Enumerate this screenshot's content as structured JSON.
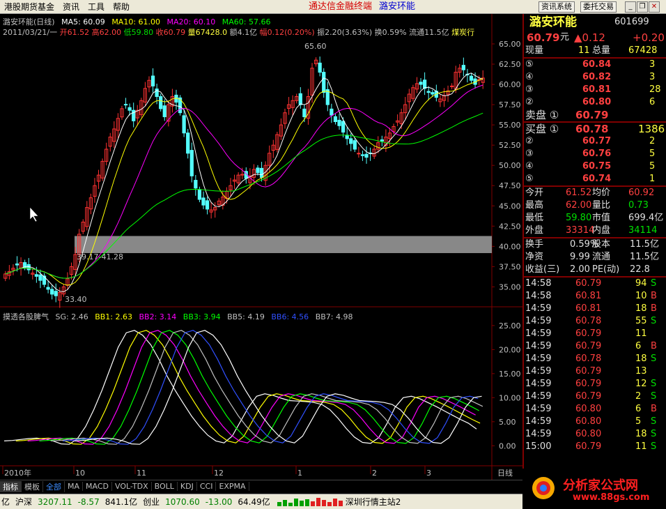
{
  "menubar": {
    "title": "港股期货基金",
    "menu1": "资讯",
    "menu2": "工具",
    "menu3": "帮助",
    "center": "通达信金融终端",
    "stock": "潞安环能",
    "btn1": "资讯系统",
    "btn2": "委托交易"
  },
  "legend": {
    "name": "潞安环能(日线)",
    "ma5": "MA5: 60.09",
    "ma10": "MA10: 61.00",
    "ma20": "MA20: 60.10",
    "ma60": "MA60: 57.66"
  },
  "info": {
    "date": "2011/03/21/一",
    "open": "开61.52",
    "high": "高62.00",
    "low": "低59.80",
    "close": "收60.79",
    "vol": "量67428.0",
    "amt": "额4.1亿",
    "chg": "幅0.12(0.20%)",
    "amp": "振2.20(3.63%)",
    "turn": "换0.59%",
    "flow": "流通11.5亿",
    "ind": "煤炭行"
  },
  "sub": {
    "name": "摸透各股脾气",
    "sg": "SG: 2.46",
    "bb1": "BB1: 2.63",
    "bb2": "BB2: 3.14",
    "bb3": "BB3: 3.94",
    "bb5": "BB5: 4.19",
    "bb6": "BB6: 4.56",
    "bb7": "BB7: 4.98"
  },
  "tags": {
    "high": "65.60",
    "low": "33.40",
    "range": "39.17-41.28"
  },
  "timeaxis": {
    "year": "2010年",
    "m10": "10",
    "m11": "11",
    "m12": "12",
    "m1": "1",
    "m2": "2",
    "m3": "3",
    "period": "日线"
  },
  "tabs": [
    "指标",
    "模板",
    "全部",
    "MA",
    "MACD",
    "VOL-TDX",
    "BOLL",
    "KDJ",
    "CCI",
    "EXPMA"
  ],
  "status": {
    "prefix": "亿",
    "sh": "沪深",
    "shv": "3207.11",
    "shc": "-8.57",
    "sha": "841.1亿",
    "cy": "创业",
    "cyv": "1070.60",
    "cyc": "-13.00",
    "cya": "64.49亿",
    "server": "深圳行情主站2"
  },
  "quote": {
    "name": "潞安环能",
    "code": "601699",
    "price": "60.79",
    "unit": "元",
    "chg": "▲0.12",
    "chg2": "+0.20",
    "xl_label": "现量",
    "xl": "11",
    "zl_label": "总量",
    "zl": "67428"
  },
  "sells": [
    {
      "l": "⑤",
      "p": "60.84",
      "v": "3"
    },
    {
      "l": "④",
      "p": "60.82",
      "v": "3"
    },
    {
      "l": "③",
      "p": "60.81",
      "v": "28"
    },
    {
      "l": "②",
      "p": "60.80",
      "v": "6"
    },
    {
      "l": "卖盘 ①",
      "p": "60.79",
      "v": ""
    }
  ],
  "buys": [
    {
      "l": "买盘 ①",
      "p": "60.78",
      "v": "1386"
    },
    {
      "l": "②",
      "p": "60.77",
      "v": "2"
    },
    {
      "l": "③",
      "p": "60.76",
      "v": "5"
    },
    {
      "l": "④",
      "p": "60.75",
      "v": "5"
    },
    {
      "l": "⑤",
      "p": "60.74",
      "v": "1"
    }
  ],
  "stats1": [
    {
      "a": "今开",
      "b": "61.52",
      "c": "均价",
      "d": "60.92"
    },
    {
      "a": "最高",
      "b": "62.00",
      "c": "量比",
      "d": "0.73"
    },
    {
      "a": "最低",
      "b": "59.80",
      "c": "市值",
      "d": "699.4亿"
    },
    {
      "a": "外盘",
      "b": "33314",
      "c": "内盘",
      "d": "34114"
    }
  ],
  "stats2": [
    {
      "a": "换手",
      "b": "0.59%",
      "c": "股本",
      "d": "11.5亿"
    },
    {
      "a": "净资",
      "b": "9.99",
      "c": "流通",
      "d": "11.5亿"
    },
    {
      "a": "收益(三)",
      "b": "2.00",
      "c": "PE(动)",
      "d": "22.8"
    }
  ],
  "ticks": [
    {
      "t": "14:58",
      "p": "60.79",
      "v": "94",
      "s": "S"
    },
    {
      "t": "14:58",
      "p": "60.81",
      "v": "10",
      "s": "B"
    },
    {
      "t": "14:59",
      "p": "60.81",
      "v": "18",
      "s": "B"
    },
    {
      "t": "14:59",
      "p": "60.78",
      "v": "55",
      "s": "S"
    },
    {
      "t": "14:59",
      "p": "60.79",
      "v": "11",
      "s": ""
    },
    {
      "t": "14:59",
      "p": "60.79",
      "v": "6",
      "s": "B"
    },
    {
      "t": "14:59",
      "p": "60.78",
      "v": "18",
      "s": "S"
    },
    {
      "t": "14:59",
      "p": "60.79",
      "v": "13",
      "s": ""
    },
    {
      "t": "14:59",
      "p": "60.79",
      "v": "12",
      "s": "S"
    },
    {
      "t": "14:59",
      "p": "60.79",
      "v": "2",
      "s": "S"
    },
    {
      "t": "14:59",
      "p": "60.80",
      "v": "6",
      "s": "B"
    },
    {
      "t": "14:59",
      "p": "60.80",
      "v": "5",
      "s": "S"
    },
    {
      "t": "14:59",
      "p": "60.80",
      "v": "18",
      "s": "S"
    },
    {
      "t": "15:00",
      "p": "60.79",
      "v": "11",
      "s": "S"
    }
  ],
  "yaxis_main": [
    "65.00",
    "62.50",
    "60.00",
    "57.50",
    "55.00",
    "52.50",
    "50.00",
    "47.50",
    "45.00",
    "42.50",
    "40.00",
    "37.50",
    "35.00"
  ],
  "yaxis_sub": [
    "25.00",
    "20.00",
    "15.00",
    "10.00",
    "5.00",
    "0.00"
  ],
  "logo": {
    "text": "分析家公式网",
    "url": "www.88gs.com"
  },
  "colors": {
    "ma5": "#ffffff",
    "ma10": "#ffff00",
    "ma20": "#ff00ff",
    "ma60": "#00ff00",
    "up": "#ff3232",
    "down": "#54ffff",
    "border": "#800000"
  },
  "chart_data": {
    "type": "candlestick",
    "ylim": [
      33.4,
      65.6
    ],
    "sub_ylim": [
      -3,
      26
    ],
    "closes": [
      36.6,
      36.9,
      37.3,
      37.7,
      38.0,
      37.4,
      37.1,
      36.7,
      36.3,
      35.8,
      35.3,
      34.7,
      34.1,
      33.9,
      34.3,
      35.0,
      36.0,
      37.5,
      39.0,
      41.5,
      43.0,
      44.8,
      46.0,
      47.5,
      48.8,
      50.5,
      52.0,
      53.5,
      54.5,
      55.8,
      57.0,
      57.5,
      56.8,
      55.5,
      56.8,
      58.0,
      59.5,
      60.5,
      59.8,
      58.5,
      57.0,
      56.0,
      57.5,
      58.5,
      57.8,
      56.5,
      54.0,
      51.5,
      48.7,
      47.2,
      45.8,
      45.1,
      44.6,
      44.5,
      44.8,
      45.6,
      46.1,
      46.8,
      47.5,
      48.2,
      48.8,
      48.9,
      48.4,
      48.7,
      49.5,
      49.1,
      48.5,
      50.0,
      51.5,
      52.5,
      53.8,
      55.0,
      56.5,
      57.5,
      58.0,
      58.5,
      57.5,
      56.0,
      58.5,
      62.0,
      63.0,
      61.5,
      59.0,
      57.5,
      56.2,
      55.4,
      54.9,
      54.1,
      53.3,
      52.7,
      52.0,
      51.5,
      51.2,
      51.0,
      51.5,
      52.0,
      52.8,
      53.0,
      53.5,
      54.0,
      54.8,
      55.5,
      56.5,
      57.5,
      58.8,
      59.6,
      60.1,
      60.0,
      59.5,
      59.0,
      58.8,
      58.4,
      58.2,
      58.6,
      59.2,
      59.8,
      61.5,
      62.0,
      61.8,
      61.2,
      60.5,
      60.0,
      60.6,
      60.79
    ],
    "sub_bases": [
      1.0,
      1.1,
      1.3,
      1.5,
      1.6,
      1.4,
      1.0,
      0.4,
      0.3,
      1.5,
      4.0,
      7.5,
      11.5,
      16.0,
      20.5,
      23.5,
      24.0,
      23.0,
      21.0,
      18.0,
      14.5,
      11.5,
      8.8,
      6.2,
      4.0,
      2.2,
      1.0,
      0.6,
      2.0,
      5.0,
      8.0,
      10.3,
      10.8,
      10.5,
      9.9,
      9.4,
      9.3,
      9.2,
      9.0,
      8.6,
      7.5,
      5.7,
      3.6,
      1.8,
      0.7,
      0.5,
      1.7,
      4.6,
      8.0,
      10.0,
      10.3,
      9.8,
      9.0,
      8.2,
      7.3,
      6.4,
      5.5,
      4.7,
      3.5
    ]
  }
}
